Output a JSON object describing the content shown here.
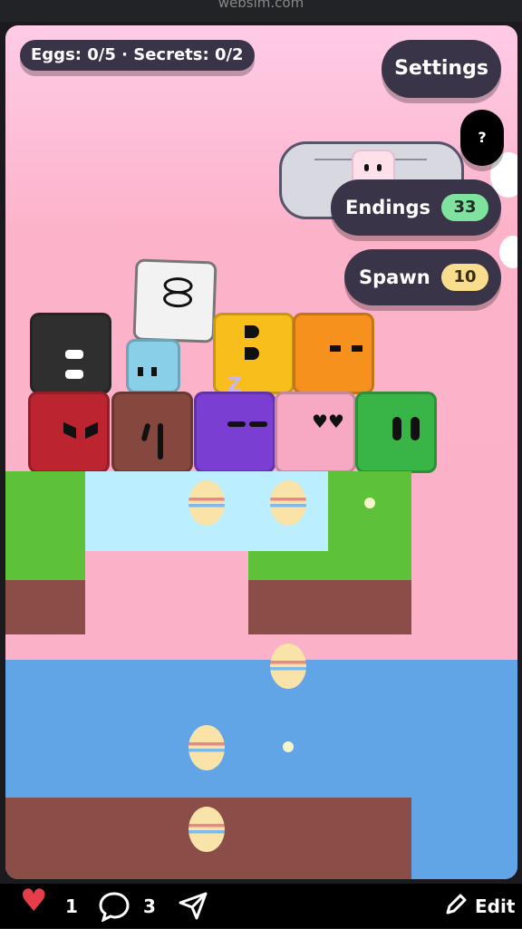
{
  "browser": {
    "url_fragment": "websim.com"
  },
  "hud": {
    "counter": "Eggs: 0/5 · Secrets: 0/2",
    "settings_label": "Settings",
    "help_label": "?",
    "endings_label": "Endings",
    "endings_count": "33",
    "spawn_label": "Spawn",
    "spawn_count": "10"
  },
  "colors": {
    "sky_top": "#ffcbe6",
    "sky": "#fab0c6",
    "pill_bg": "#3a3448",
    "endings_badge": "#7fe39f",
    "spawn_badge": "#f9dd8e",
    "grass": "#5dc23a",
    "dirt": "#8b4d48",
    "ice": "#bbeeff",
    "water": "#62a5e6"
  },
  "blocks": [
    {
      "name": "white-block",
      "color": "#f2f2f2",
      "face": "O O"
    },
    {
      "name": "black-block",
      "color": "#2f2f2f",
      "face": "white bars"
    },
    {
      "name": "light-blue-block",
      "color": "#88cfe7",
      "face": "dots"
    },
    {
      "name": "yellow-block",
      "color": "#f7be1c",
      "face": "half circles"
    },
    {
      "name": "orange-block",
      "color": "#f7911e",
      "face": "dashes"
    },
    {
      "name": "red-block",
      "color": "#bc2430",
      "face": "angry"
    },
    {
      "name": "brown-block",
      "color": "#86473e",
      "face": "scribble"
    },
    {
      "name": "purple-block",
      "color": "#7a3fd2",
      "face": "sleepy"
    },
    {
      "name": "pink-block",
      "color": "#f7a9c4",
      "face": "hearts"
    },
    {
      "name": "green-block",
      "color": "#39b447",
      "face": "tall eyes"
    }
  ],
  "eggs_visible": 5,
  "bottom_bar": {
    "likes": "1",
    "comments": "3",
    "edit_label": "Edit"
  }
}
